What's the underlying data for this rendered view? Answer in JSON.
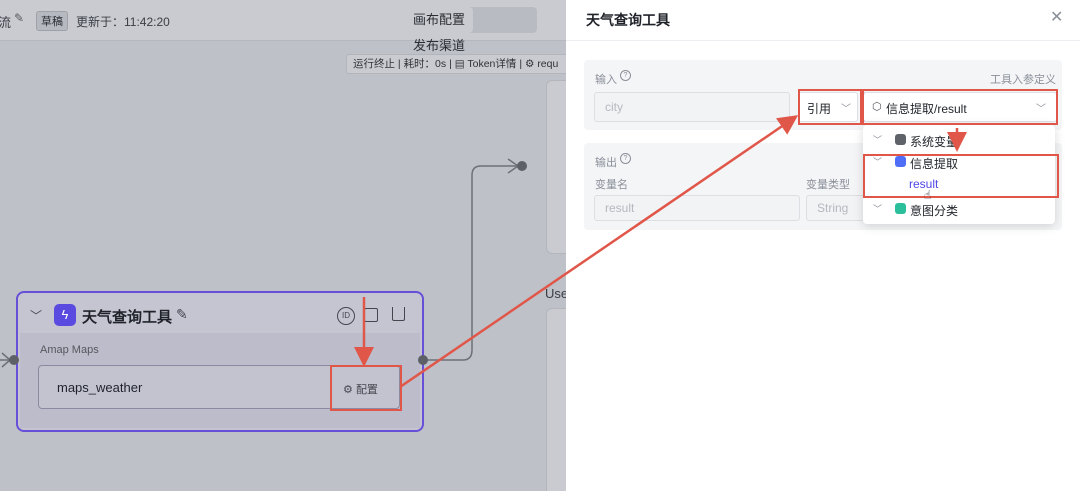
{
  "header": {
    "title_char": "流",
    "draft_badge": "草稿",
    "updated_at": "更新于：11:42:20",
    "tab_canvas": "画布配置",
    "tab_publish": "发布渠道"
  },
  "run_status": {
    "status": "运行终止",
    "duration": "耗时：0s",
    "token_detail": "Token详情",
    "request_prefix": "requ"
  },
  "side_peek": {
    "use_text": "Use"
  },
  "node": {
    "title": "天气查询工具",
    "subtitle": "Amap Maps",
    "tool_name": "maps_weather",
    "config_label": "配置",
    "id_icon_text": "ID"
  },
  "drawer": {
    "title": "天气查询工具",
    "input_section": {
      "label": "输入",
      "right_label": "工具入参定义",
      "param_placeholder": "city",
      "mode_value": "引用",
      "ref_value": "信息提取/result"
    },
    "output_section": {
      "label": "输出",
      "col_var_name": "变量名",
      "col_var_type": "变量类型",
      "var_name_value": "result",
      "var_type_value": "String"
    },
    "dropdown": {
      "items": [
        {
          "label": "系统变量"
        },
        {
          "label": "信息提取",
          "child": "result"
        },
        {
          "label": "意图分类"
        }
      ]
    }
  },
  "colors": {
    "accent": "#5b4ae0",
    "annotation_red": "#e0574a",
    "node_border": "#6650d8"
  }
}
